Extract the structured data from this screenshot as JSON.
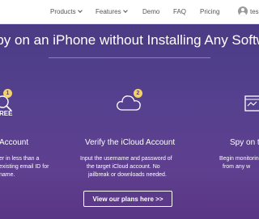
{
  "nav": {
    "products": "Products",
    "features": "Features",
    "demo": "Demo",
    "faq": "FAQ",
    "pricing": "Pricing",
    "user": "tes"
  },
  "hero": {
    "headline": "Spy on an iPhone without Installing Any Software",
    "button": "View our plans here >>",
    "steps": [
      {
        "badge": "1",
        "icon_label": "REE",
        "title": "Account",
        "lines": [
          "er in less than a",
          "existing email ID for",
          "name."
        ]
      },
      {
        "badge": "2",
        "title": "Verify the iCloud Account",
        "lines": [
          "Input the username and password of",
          "the target iCloud account. No",
          "jailbreak or downloads needed."
        ]
      },
      {
        "title": "Spy on th",
        "lines": [
          "Begin monitoring",
          "from any w"
        ]
      }
    ]
  },
  "colors": {
    "hero_bg": "#55418f",
    "badge": "#f3d16b",
    "nav_bg": "#ffffff"
  }
}
